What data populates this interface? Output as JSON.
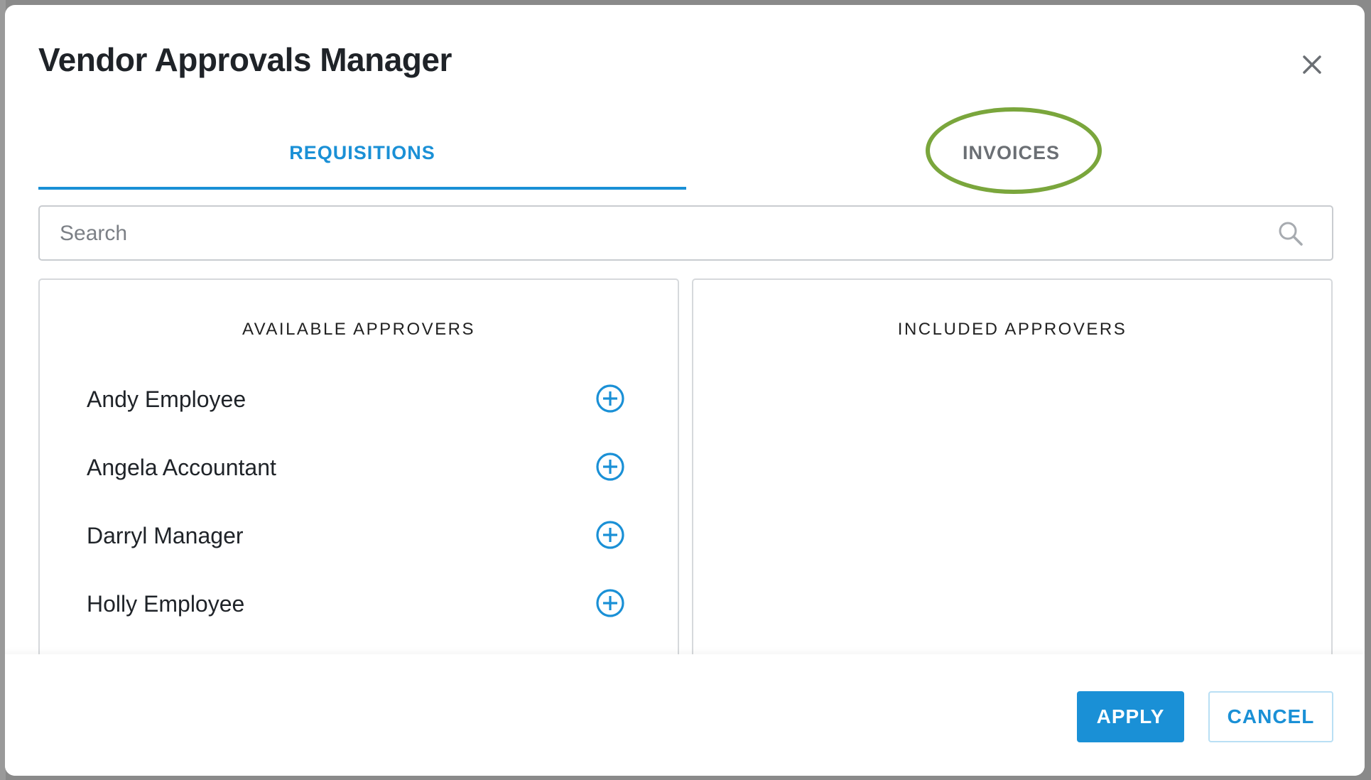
{
  "dialog": {
    "title": "Vendor Approvals Manager",
    "close_icon": "close-icon"
  },
  "tabs": [
    {
      "label": "REQUISITIONS",
      "active": true
    },
    {
      "label": "INVOICES",
      "active": false
    }
  ],
  "annotation": {
    "highlight_color": "#7aa63c"
  },
  "search": {
    "placeholder": "Search",
    "value": "",
    "icon": "search-icon"
  },
  "available_approvers": {
    "heading": "AVAILABLE APPROVERS",
    "items": [
      {
        "name": "Andy Employee",
        "action_icon": "add-circle-icon"
      },
      {
        "name": "Angela Accountant",
        "action_icon": "add-circle-icon"
      },
      {
        "name": "Darryl Manager",
        "action_icon": "add-circle-icon"
      },
      {
        "name": "Holly Employee",
        "action_icon": "add-circle-icon"
      }
    ]
  },
  "included_approvers": {
    "heading": "INCLUDED APPROVERS",
    "items": []
  },
  "footer": {
    "apply_label": "APPLY",
    "cancel_label": "CANCEL"
  },
  "colors": {
    "accent": "#1a90d6",
    "title_text": "#1f2328",
    "inactive_tab": "#6b6f74",
    "highlight_ring": "#7aa63c"
  }
}
